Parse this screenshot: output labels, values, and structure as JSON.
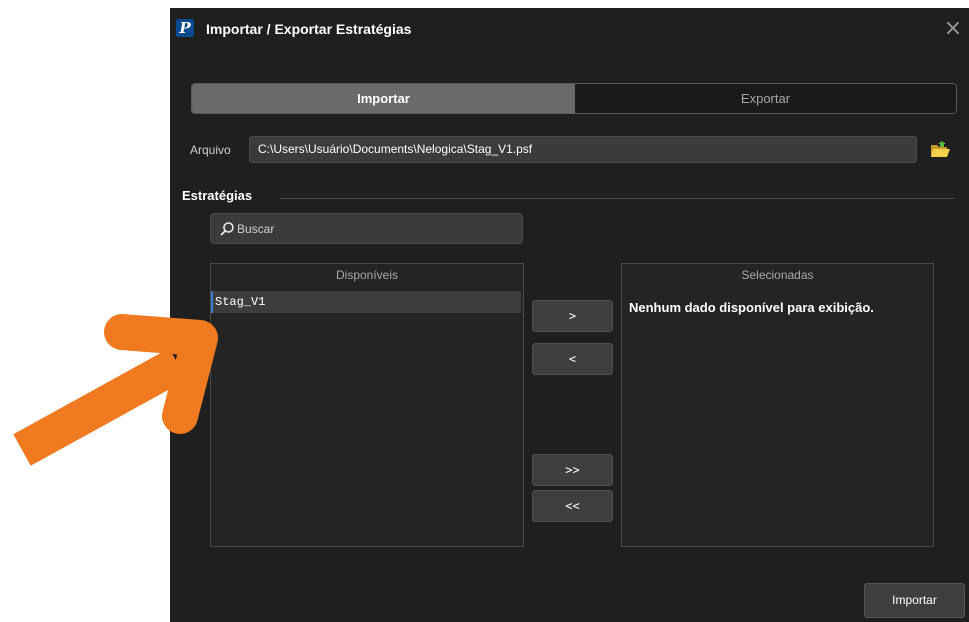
{
  "window": {
    "title": "Importar / Exportar Estratégias",
    "app_icon_letter": "P",
    "close_symbol": "×"
  },
  "tabs": [
    {
      "label": "Importar",
      "active": true
    },
    {
      "label": "Exportar",
      "active": false
    }
  ],
  "file": {
    "label": "Arquivo",
    "value": "C:\\Users\\Usuário\\Documents\\Nelogica\\Stag_V1.psf",
    "browse_icon": "folder-open-icon"
  },
  "strategies": {
    "section_title": "Estratégias",
    "search": {
      "placeholder": "Buscar",
      "icon": "search-icon"
    },
    "available": {
      "header": "Disponíveis",
      "items": [
        "Stag_V1"
      ]
    },
    "selected": {
      "header": "Selecionadas",
      "empty_message": "Nenhum dado disponível para exibição."
    },
    "buttons": {
      "move_right": ">",
      "move_left": "<",
      "move_all_right": ">>",
      "move_all_left": "<<"
    }
  },
  "footer": {
    "import_label": "Importar"
  },
  "colors": {
    "annotation_arrow": "#f07a20",
    "accent_blue": "#3a7bd5",
    "window_bg": "#1f1f1f"
  }
}
